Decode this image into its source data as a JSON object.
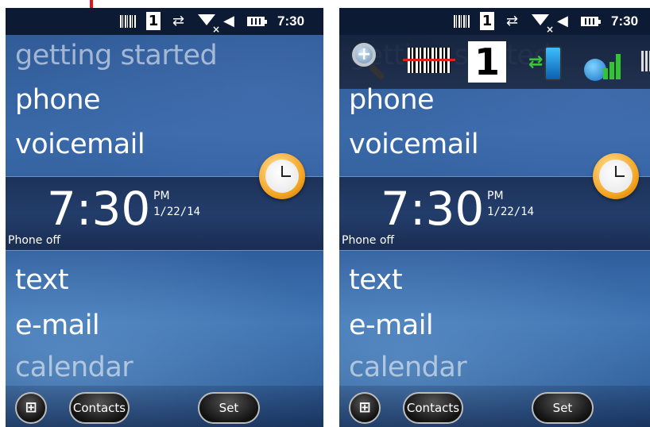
{
  "status": {
    "clock": "7:30",
    "sim_number": "1"
  },
  "tray": {
    "sim_number": "1"
  },
  "menu": {
    "getting_started": "getting started",
    "phone": "phone",
    "voicemail": "voicemail",
    "text": "text",
    "email": "e-mail",
    "calendar": "calendar"
  },
  "time_panel": {
    "time": "7:30",
    "ampm": "PM",
    "date": "1/22/14",
    "phone_state": "Phone off"
  },
  "softkeys": {
    "contacts": "Contacts",
    "set": "Set"
  },
  "icons": {
    "status": [
      "barcode-icon",
      "sim-icon",
      "data-transfer-icon",
      "no-signal-icon",
      "speaker-mute-icon",
      "battery-icon"
    ],
    "tray": [
      "zoom-icon",
      "barcode-scanner-icon",
      "sim-icon",
      "sync-icon",
      "phone-signal-icon",
      "more-icon"
    ]
  },
  "colors": {
    "arrow": "#e3151a",
    "statusbar": "#0d1a33",
    "background": "#2e5894"
  }
}
